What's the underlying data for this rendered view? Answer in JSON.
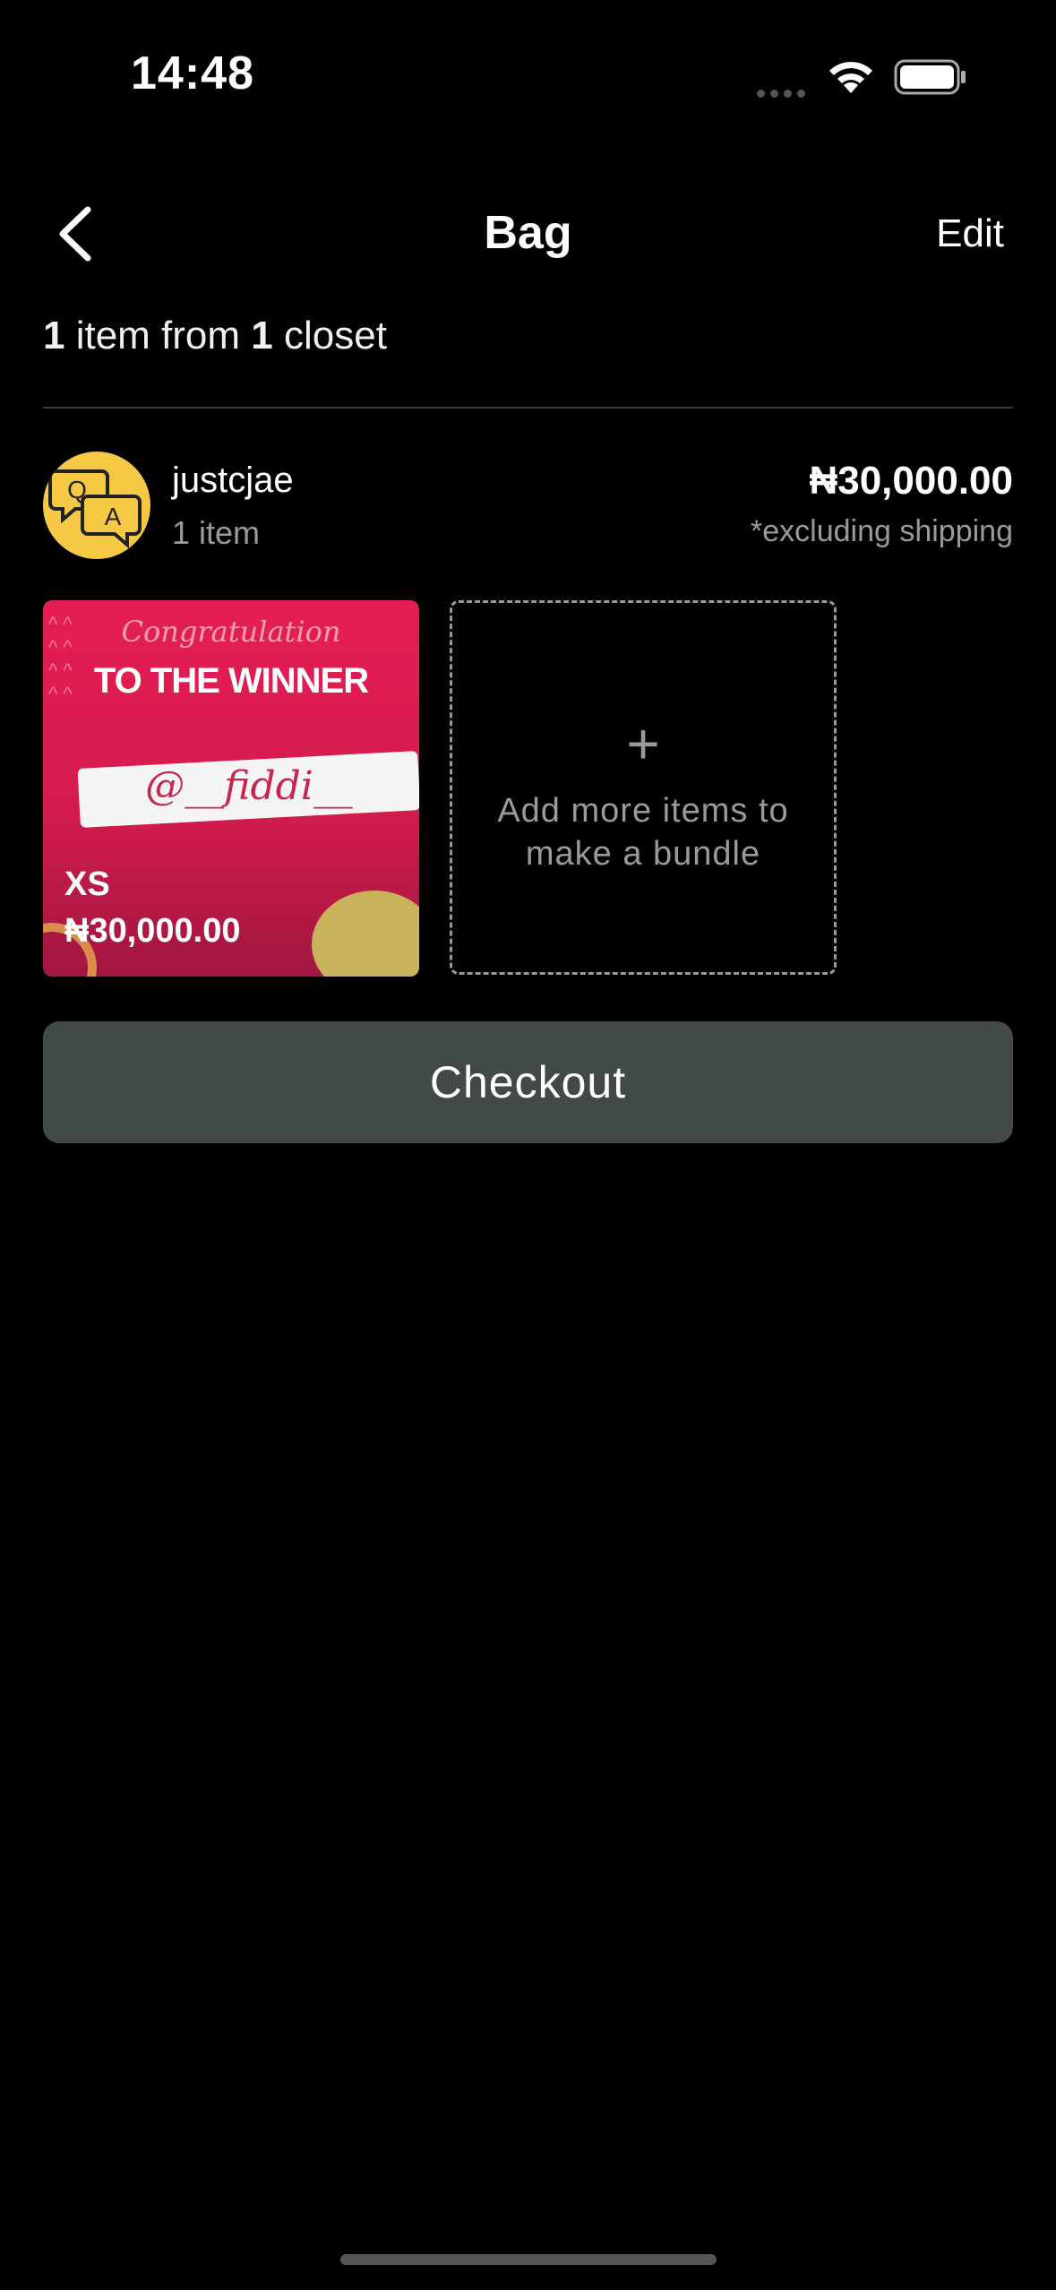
{
  "status_bar": {
    "time": "14:48"
  },
  "nav": {
    "title": "Bag",
    "edit_label": "Edit"
  },
  "summary": {
    "item_count": "1",
    "item_text": " item from ",
    "closet_count": "1",
    "closet_text": " closet"
  },
  "closet": {
    "name": "justcjae",
    "count": "1 item",
    "total": "₦30,000.00",
    "shipping_note": "*excluding shipping",
    "avatar_letters": [
      "Q",
      "A"
    ]
  },
  "product": {
    "image_text": {
      "congrats": "Congratulation",
      "headline": "TO THE WINNER",
      "handle": "@__fiddi__"
    },
    "size": "XS",
    "price": "₦30,000.00"
  },
  "bundle": {
    "plus": "+",
    "text_line1": "Add more items to",
    "text_line2": "make a bundle"
  },
  "checkout": {
    "label": "Checkout"
  },
  "colors": {
    "background": "#000000",
    "checkout_bg": "#424a46",
    "avatar_bg": "#f6c945",
    "product_bg": "#e51e53"
  }
}
